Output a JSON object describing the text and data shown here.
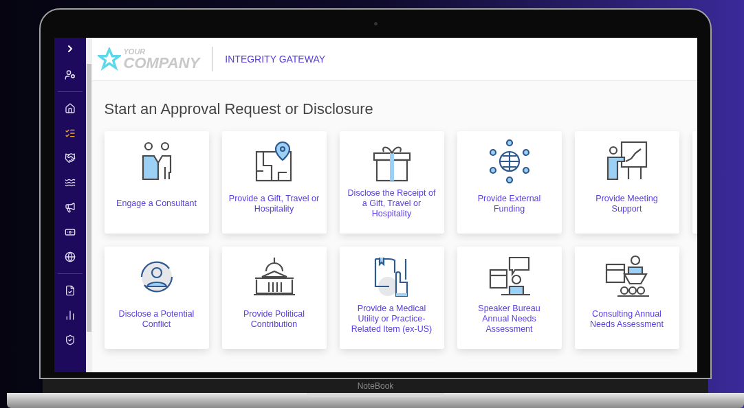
{
  "header": {
    "logo_top": "YOUR",
    "logo_bottom": "COMPANY",
    "app_title": "INTEGRITY GATEWAY"
  },
  "sidebar": {
    "items": [
      {
        "selected": false
      },
      {
        "selected": false
      },
      {
        "selected": true
      },
      {
        "selected": false
      },
      {
        "selected": false
      },
      {
        "selected": false
      },
      {
        "selected": false
      },
      {
        "selected": false
      },
      {
        "selected": false
      },
      {
        "selected": false
      },
      {
        "selected": false
      }
    ]
  },
  "page_title": "Start an Approval Request or Disclosure",
  "cards": [
    {
      "label": "Engage a Consultant"
    },
    {
      "label": "Provide a Gift, Travel or Hospitality"
    },
    {
      "label": "Disclose the Receipt of a Gift, Travel or Hospitality"
    },
    {
      "label": "Provide External Funding"
    },
    {
      "label": "Provide Meeting Support"
    },
    {
      "label": "Disclose a Potential Conflict"
    },
    {
      "label": "Provide Political Contribution"
    },
    {
      "label": "Provide a Medical Utility or Practice-Related Item (ex-US)"
    },
    {
      "label": "Speaker Bureau Annual Needs Assessment"
    },
    {
      "label": "Consulting Annual Needs Assessment"
    }
  ],
  "laptop": {
    "brand": "NoteBook"
  }
}
